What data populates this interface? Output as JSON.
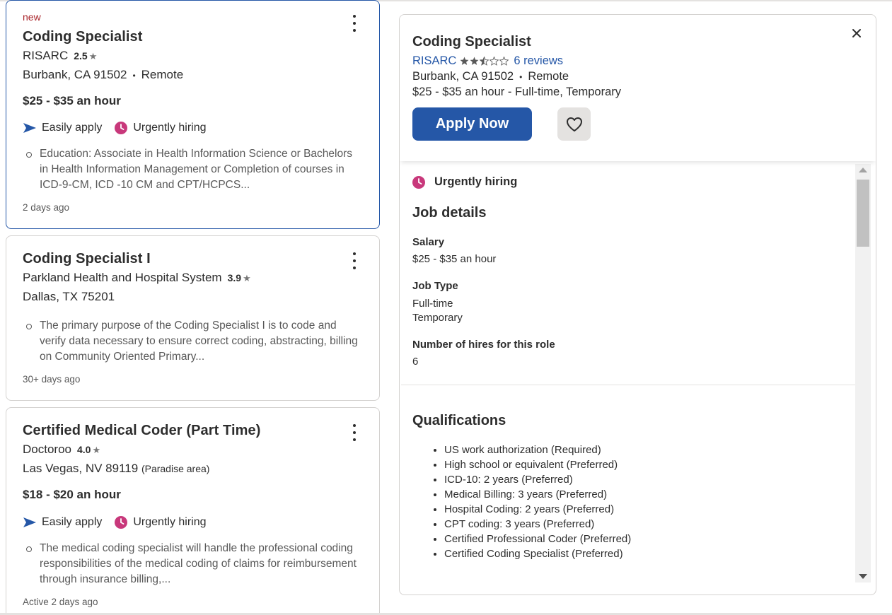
{
  "colors": {
    "brand_blue": "#2557a7",
    "urgent_pink": "#c8387b",
    "new_red": "#a9252b"
  },
  "jobs": [
    {
      "new_tag": "new",
      "title": "Coding Specialist",
      "company": "RISARC",
      "rating": "2.5",
      "location": "Burbank, CA 91502",
      "remote": "Remote",
      "salary": "$25 - $35 an hour",
      "easily_apply": "Easily apply",
      "urgently_hiring": "Urgently hiring",
      "snippet": "Education: Associate in Health Information Science or Bachelors in Health Information Management or Completion of courses in ICD-9-CM, ICD -10 CM and CPT/HCPCS...",
      "date": "2 days ago"
    },
    {
      "title": "Coding Specialist I",
      "company": "Parkland Health and Hospital System",
      "rating": "3.9",
      "location": "Dallas, TX 75201",
      "snippet": "The primary purpose of the Coding Specialist I is to code and verify data necessary to ensure correct coding, abstracting, billing on Community Oriented Primary...",
      "date": "30+ days ago"
    },
    {
      "title": "Certified Medical Coder (Part Time)",
      "company": "Doctoroo",
      "rating": "4.0",
      "location": "Las Vegas, NV 89119",
      "location_sub": "(Paradise area)",
      "salary": "$18 - $20 an hour",
      "easily_apply": "Easily apply",
      "urgently_hiring": "Urgently hiring",
      "snippet": "The medical coding specialist will handle the professional coding responsibilities of the medical coding of claims for reimbursement through insurance billing,...",
      "date": "Active 2 days ago"
    }
  ],
  "detail": {
    "title": "Coding Specialist",
    "company": "RISARC",
    "star_rating": 2.5,
    "reviews": "6 reviews",
    "location": "Burbank, CA 91502",
    "remote": "Remote",
    "salary_line": "$25 - $35 an hour",
    "type_line": " - Full-time, Temporary",
    "apply_label": "Apply Now",
    "urgently_hiring": "Urgently hiring",
    "job_details_title": "Job details",
    "salary_label": "Salary",
    "salary_value": "$25 - $35 an hour",
    "job_type_label": "Job Type",
    "job_type_values": [
      "Full-time",
      "Temporary"
    ],
    "hires_label": "Number of hires for this role",
    "hires_value": "6",
    "qualifications_title": "Qualifications",
    "qualifications": [
      "US work authorization (Required)",
      "High school or equivalent (Preferred)",
      "ICD-10: 2 years (Preferred)",
      "Medical Billing: 3 years (Preferred)",
      "Hospital Coding: 2 years (Preferred)",
      "CPT coding: 3 years (Preferred)",
      "Certified Professional Coder (Preferred)",
      "Certified Coding Specialist (Preferred)"
    ]
  }
}
